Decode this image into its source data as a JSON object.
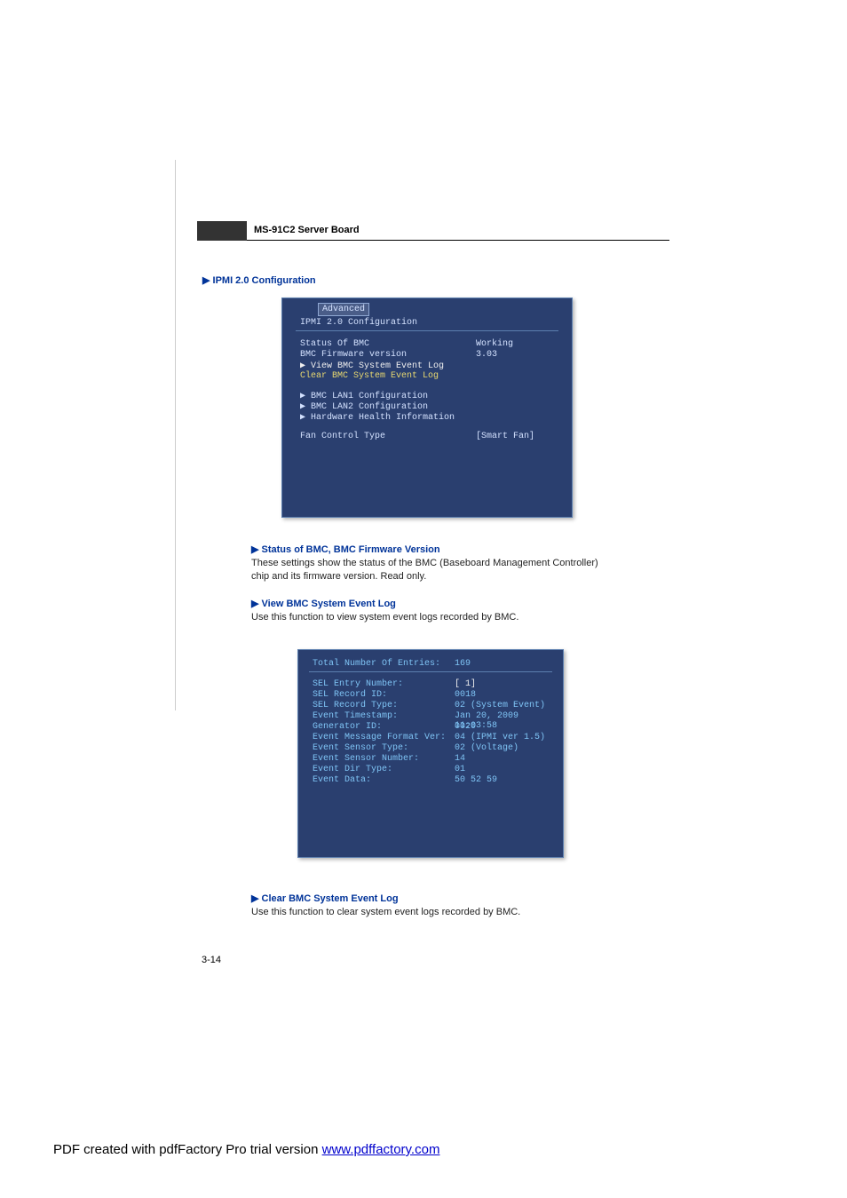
{
  "header_title": "MS-91C2 Server Board",
  "section_title": "▶ IPMI 2.0 Configuration",
  "bios1": {
    "tab": "Advanced",
    "title": "IPMI 2.0 Configuration",
    "rows": [
      {
        "label": "Status Of BMC",
        "value": "Working",
        "cls": ""
      },
      {
        "label": "BMC Firmware version",
        "value": "3.03",
        "cls": ""
      },
      {
        "label": "▶ View BMC System Event Log",
        "value": "",
        "cls": "bios-white"
      },
      {
        "label": "Clear BMC System Event Log",
        "value": "",
        "cls": "bios-yellow"
      }
    ],
    "group2": [
      {
        "label": "▶ BMC LAN1 Configuration"
      },
      {
        "label": "▶ BMC LAN2 Configuration"
      },
      {
        "label": "▶ Hardware Health Information"
      }
    ],
    "fan": {
      "label": "Fan Control Type",
      "value": "[Smart Fan]"
    }
  },
  "para1": {
    "heading": "▶ Status of BMC, BMC Firmware Version",
    "text": "These settings show the status of the BMC (Baseboard Management Controller) chip and its firmware version. Read only."
  },
  "para2": {
    "heading": "▶ View BMC System Event Log",
    "text": "Use this function to view system event logs recorded by BMC."
  },
  "bios2": {
    "header": {
      "label": "Total Number Of Entries:",
      "value": "169"
    },
    "rows": [
      {
        "label": "SEL Entry Number:",
        "value": "[  1]",
        "white": true
      },
      {
        "label": "SEL Record ID:",
        "value": "0018"
      },
      {
        "label": "SEL Record Type:",
        "value": "02 (System Event)"
      },
      {
        "label": "Event Timestamp:",
        "value": "Jan 20, 2009 11:03:58"
      },
      {
        "label": "Generator ID:",
        "value": "0020"
      },
      {
        "label": "Event Message Format Ver:",
        "value": "04 (IPMI ver 1.5)"
      },
      {
        "label": "Event Sensor Type:",
        "value": "02 (Voltage)"
      },
      {
        "label": "Event Sensor Number:",
        "value": "14"
      },
      {
        "label": "Event Dir Type:",
        "value": "01"
      },
      {
        "label": "Event Data:",
        "value": "50 52 59"
      }
    ]
  },
  "para3": {
    "heading": "▶ Clear BMC System Event Log",
    "text": "Use this function to clear system event logs recorded by BMC."
  },
  "page_num": "3-14",
  "footer_text": "PDF created with pdfFactory Pro trial version ",
  "footer_link": "www.pdffactory.com"
}
